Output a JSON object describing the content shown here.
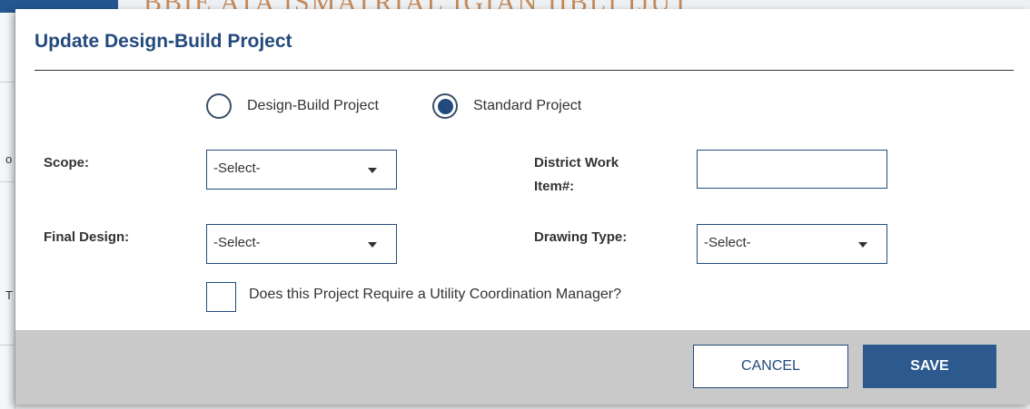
{
  "background": {
    "title_fragment": "BBIE ATA ISMATRIAL IGIAN IIBLI IJUT",
    "left_fragments": [
      "o",
      "T"
    ]
  },
  "modal": {
    "title": "Update Design-Build Project",
    "project_type": {
      "options": [
        {
          "label": "Design-Build Project",
          "selected": false
        },
        {
          "label": "Standard Project",
          "selected": true
        }
      ]
    },
    "scope": {
      "label": "Scope:",
      "value": "-Select-"
    },
    "district_work_item": {
      "label_line1": "District Work",
      "label_line2": "Item#:",
      "value": ""
    },
    "final_design": {
      "label": "Final Design:",
      "value": "-Select-"
    },
    "drawing_type": {
      "label": "Drawing Type:",
      "value": "-Select-"
    },
    "utility_checkbox": {
      "label": "Does this Project Require a Utility Coordination Manager?",
      "checked": false
    },
    "buttons": {
      "cancel": "CANCEL",
      "save": "SAVE"
    }
  },
  "colors": {
    "primary": "#234a7c",
    "footer": "#c9c9c9",
    "save_button": "#2d5a8e"
  }
}
